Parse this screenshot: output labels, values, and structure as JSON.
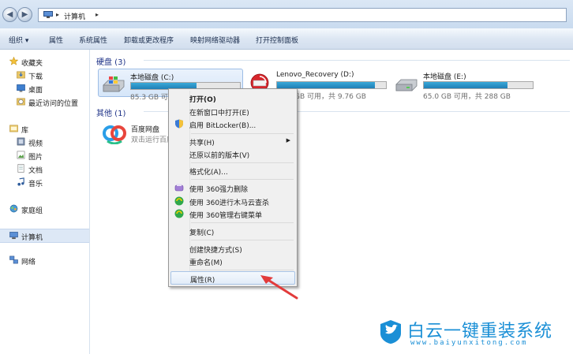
{
  "address": {
    "crumb": "计算机"
  },
  "toolbar": {
    "organize": "组织 ▾",
    "properties": "属性",
    "system_properties": "系统属性",
    "uninstall": "卸载或更改程序",
    "map_drive": "映射网络驱动器",
    "control_panel": "打开控制面板"
  },
  "nav": {
    "favorites": "收藏夹",
    "downloads": "下载",
    "desktop": "桌面",
    "recent": "最近访问的位置",
    "libraries": "库",
    "videos": "视频",
    "pictures": "图片",
    "documents": "文档",
    "music": "音乐",
    "homegroup": "家庭组",
    "computer": "计算机",
    "network": "网络"
  },
  "content": {
    "disks_header": "硬盘 (3)",
    "other_header": "其他 (1)",
    "drives": [
      {
        "name": "本地磁盘 (C:)",
        "free_text": "85.3 GB 可用",
        "used_fraction": 0.6
      },
      {
        "name": "Lenovo_Recovery (D:)",
        "free_text": "GB 可用，共 9.76 GB",
        "used_fraction": 0.9
      },
      {
        "name": "本地磁盘 (E:)",
        "free_text": "65.0 GB 可用，共 288 GB",
        "used_fraction": 0.77
      }
    ],
    "app": {
      "name": "百度网盘",
      "desc": "双击运行百度"
    }
  },
  "context_menu": {
    "open": "打开(O)",
    "open_new_window": "在新窗口中打开(E)",
    "bitlocker": "启用 BitLocker(B)...",
    "share": "共享(H)",
    "restore": "还原以前的版本(V)",
    "format": "格式化(A)...",
    "force_delete": "使用 360强力删除",
    "trojan_scan": "使用 360进行木马云查杀",
    "manage_menu": "使用 360管理右键菜单",
    "copy": "复制(C)",
    "create_shortcut": "创建快捷方式(S)",
    "rename": "重命名(M)",
    "properties": "属性(R)"
  },
  "watermark": {
    "big": "白云一键重装系统",
    "small": "www.baiyunxitong.com"
  },
  "colors": {
    "accent": "#1a8fd6",
    "drive_bar": "#2a93c9",
    "arrow": "#e23b3b"
  }
}
